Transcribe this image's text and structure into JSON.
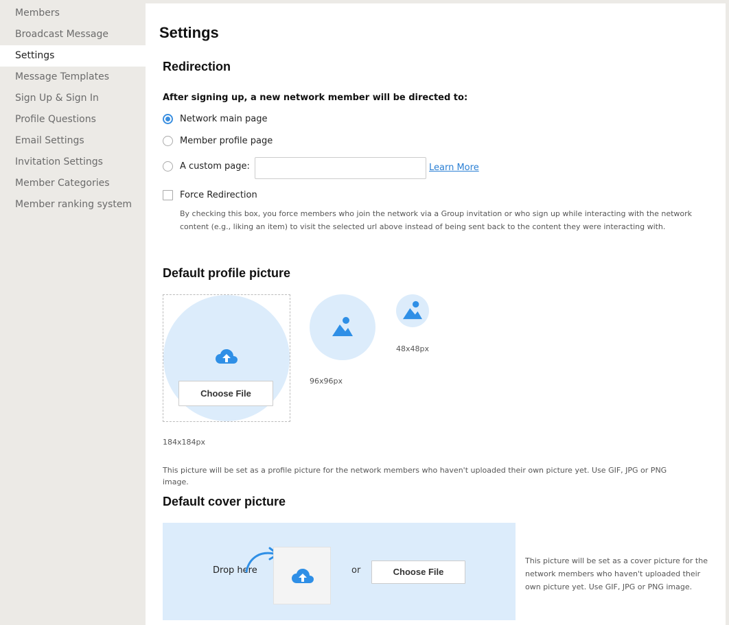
{
  "sidebar": {
    "items": [
      {
        "label": "Members"
      },
      {
        "label": "Broadcast Message"
      },
      {
        "label": "Settings"
      },
      {
        "label": "Message Templates"
      },
      {
        "label": "Sign Up & Sign In"
      },
      {
        "label": "Profile Questions"
      },
      {
        "label": "Email Settings"
      },
      {
        "label": "Invitation Settings"
      },
      {
        "label": "Member Categories"
      },
      {
        "label": "Member ranking system"
      }
    ],
    "active": "Settings"
  },
  "main": {
    "title": "Settings",
    "redirection": {
      "title": "Redirection",
      "question": "After signing up, a new network member will be directed to:",
      "options": [
        {
          "label": "Network main page",
          "checked": true
        },
        {
          "label": "Member profile page",
          "checked": false
        },
        {
          "label": "A custom page:",
          "checked": false
        }
      ],
      "custom_page_value": "",
      "learn_more": "Learn More",
      "force_label": "Force Redirection",
      "force_checked": false,
      "force_help": "By checking this box, you force members who join the network via a Group invitation or who sign up while interacting with the network content (e.g., liking an item) to visit the selected url above instead of being sent back to the content they were interacting with."
    },
    "profile_picture": {
      "title": "Default profile picture",
      "choose_file": "Choose File",
      "size_large": "184x184px",
      "size_medium": "96x96px",
      "size_small": "48x48px",
      "help": "This picture will be set as a profile picture for the network members who haven't uploaded their own picture yet. Use GIF, JPG or PNG image."
    },
    "cover_picture": {
      "title": "Default cover picture",
      "drop_here": "Drop here",
      "or": "or",
      "choose_file": "Choose File",
      "help": "This picture will be set as a cover picture for the network members who haven't uploaded their own picture yet. Use GIF, JPG or PNG image."
    }
  },
  "colors": {
    "accent": "#3a8fe0",
    "link": "#2a7fd4",
    "upload_bg": "#dcecfb",
    "icon": "#2f8fe6"
  }
}
